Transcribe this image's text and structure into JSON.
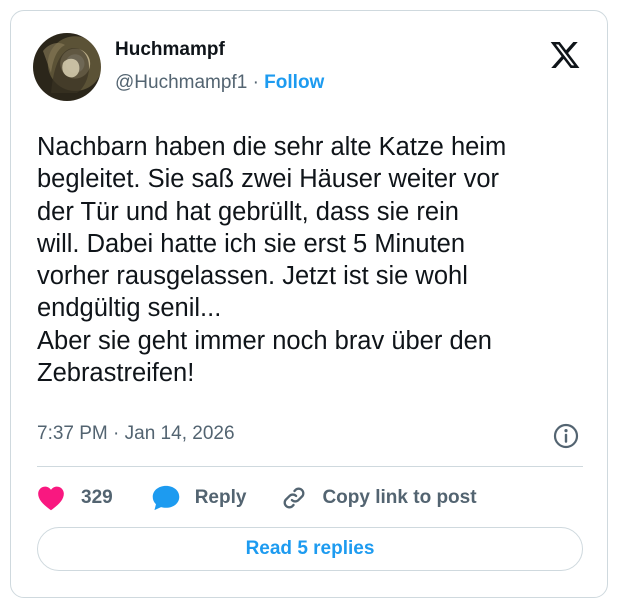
{
  "author": {
    "display_name": "Huchmampf",
    "handle": "@Huchmampf1",
    "separator": "·",
    "follow_label": "Follow"
  },
  "tweet": {
    "lines": [
      "Nachbarn haben die sehr alte Katze heim",
      "begleitet. Sie saß zwei Häuser weiter vor",
      "der Tür und hat gebrüllt, dass sie rein",
      "will. Dabei hatte ich sie erst 5 Minuten",
      "vorher rausgelassen. Jetzt ist sie wohl",
      "endgültig senil...",
      "Aber sie geht immer noch brav über den",
      "Zebrastreifen!"
    ],
    "timestamp": "7:37 PM · Jan 14, 2026"
  },
  "actions": {
    "likes_count": "329",
    "reply_label": "Reply",
    "copy_link_label": "Copy link to post"
  },
  "read_replies_label": "Read 5 replies",
  "icons": {
    "like": "heart-icon",
    "reply": "speech-bubble-icon",
    "copy_link": "link-icon",
    "info": "info-icon",
    "platform": "x-logo-icon"
  },
  "colors": {
    "accent_blue": "#1d9bf0",
    "like_pink": "#f91880",
    "text_primary": "#0f1419",
    "text_secondary": "#536471",
    "border": "#cfd9de"
  }
}
